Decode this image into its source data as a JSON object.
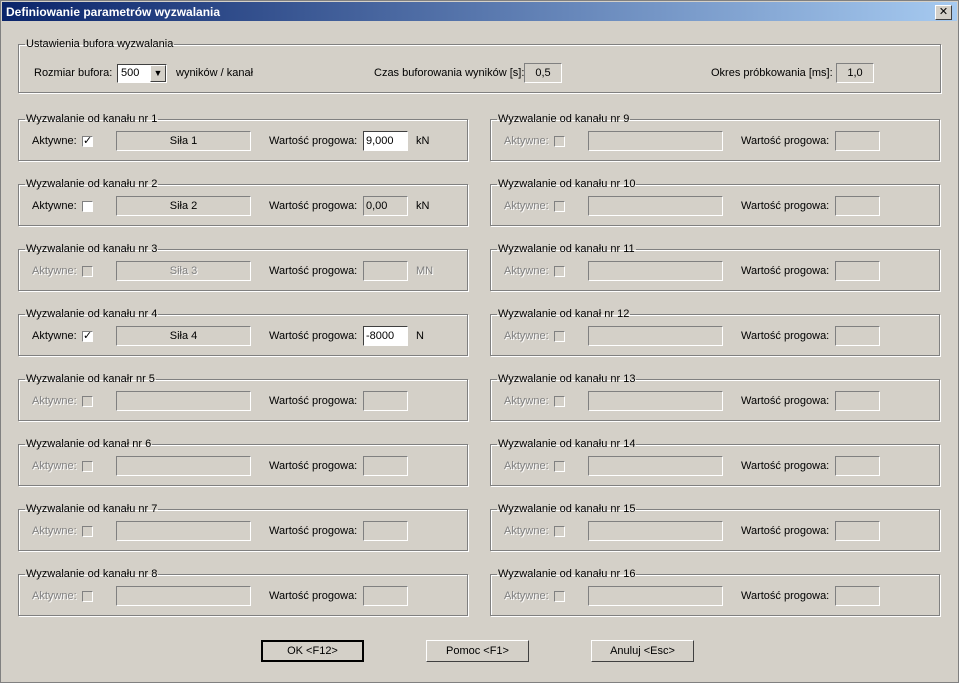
{
  "window": {
    "title": "Definiowanie parametrów wyzwalania",
    "close_label": "✕"
  },
  "buffer": {
    "legend": "Ustawienia bufora wyzwalania",
    "size_label": "Rozmiar bufora:",
    "size_value": "500",
    "size_unit": "wyników / kanał",
    "time_label": "Czas buforowania wyników [s]:",
    "time_value": "0,5",
    "period_label": "Okres próbkowania [ms]:",
    "period_value": "1,0"
  },
  "labels": {
    "active": "Aktywne:",
    "threshold": "Wartość progowa:"
  },
  "channels": [
    {
      "legend": "Wyzwalanie od kanału nr 1",
      "enabled": true,
      "checked": true,
      "name": "Siła 1",
      "threshold": "9,000",
      "unit": "kN"
    },
    {
      "legend": "Wyzwalanie od kanału nr 2",
      "enabled": true,
      "checked": false,
      "name": "Siła 2",
      "threshold": "0,00",
      "unit": "kN"
    },
    {
      "legend": "Wyzwalanie od kanału nr 3",
      "enabled": false,
      "checked": false,
      "name": "Siła 3",
      "threshold": "",
      "unit": "MN"
    },
    {
      "legend": "Wyzwalanie od kanału nr 4",
      "enabled": true,
      "checked": true,
      "name": "Siła 4",
      "threshold": "-8000",
      "unit": "N"
    },
    {
      "legend": "Wyzwalanie od kanałr nr 5",
      "enabled": false,
      "checked": false,
      "name": "",
      "threshold": "",
      "unit": ""
    },
    {
      "legend": "Wyzwalanie od kanał nr 6",
      "enabled": false,
      "checked": false,
      "name": "",
      "threshold": "",
      "unit": ""
    },
    {
      "legend": "Wyzwalanie od kanału nr 7",
      "enabled": false,
      "checked": false,
      "name": "",
      "threshold": "",
      "unit": ""
    },
    {
      "legend": "Wyzwalanie od kanału nr 8",
      "enabled": false,
      "checked": false,
      "name": "",
      "threshold": "",
      "unit": ""
    },
    {
      "legend": "Wyzwalanie od kanału nr 9",
      "enabled": false,
      "checked": false,
      "name": "",
      "threshold": "",
      "unit": ""
    },
    {
      "legend": "Wyzwalanie od kanału nr 10",
      "enabled": false,
      "checked": false,
      "name": "",
      "threshold": "",
      "unit": ""
    },
    {
      "legend": "Wyzwalanie od kanału nr 11",
      "enabled": false,
      "checked": false,
      "name": "",
      "threshold": "",
      "unit": ""
    },
    {
      "legend": "Wyzwalanie od kanał nr 12",
      "enabled": false,
      "checked": false,
      "name": "",
      "threshold": "",
      "unit": ""
    },
    {
      "legend": "Wyzwalanie od kanału nr 13",
      "enabled": false,
      "checked": false,
      "name": "",
      "threshold": "",
      "unit": ""
    },
    {
      "legend": "Wyzwalanie od kanału nr 14",
      "enabled": false,
      "checked": false,
      "name": "",
      "threshold": "",
      "unit": ""
    },
    {
      "legend": "Wyzwalanie od kanału nr 15",
      "enabled": false,
      "checked": false,
      "name": "",
      "threshold": "",
      "unit": ""
    },
    {
      "legend": "Wyzwalanie od kanału nr 16",
      "enabled": false,
      "checked": false,
      "name": "",
      "threshold": "",
      "unit": ""
    }
  ],
  "buttons": {
    "ok": "OK <F12>",
    "help": "Pomoc <F1>",
    "cancel": "Anuluj <Esc>"
  }
}
